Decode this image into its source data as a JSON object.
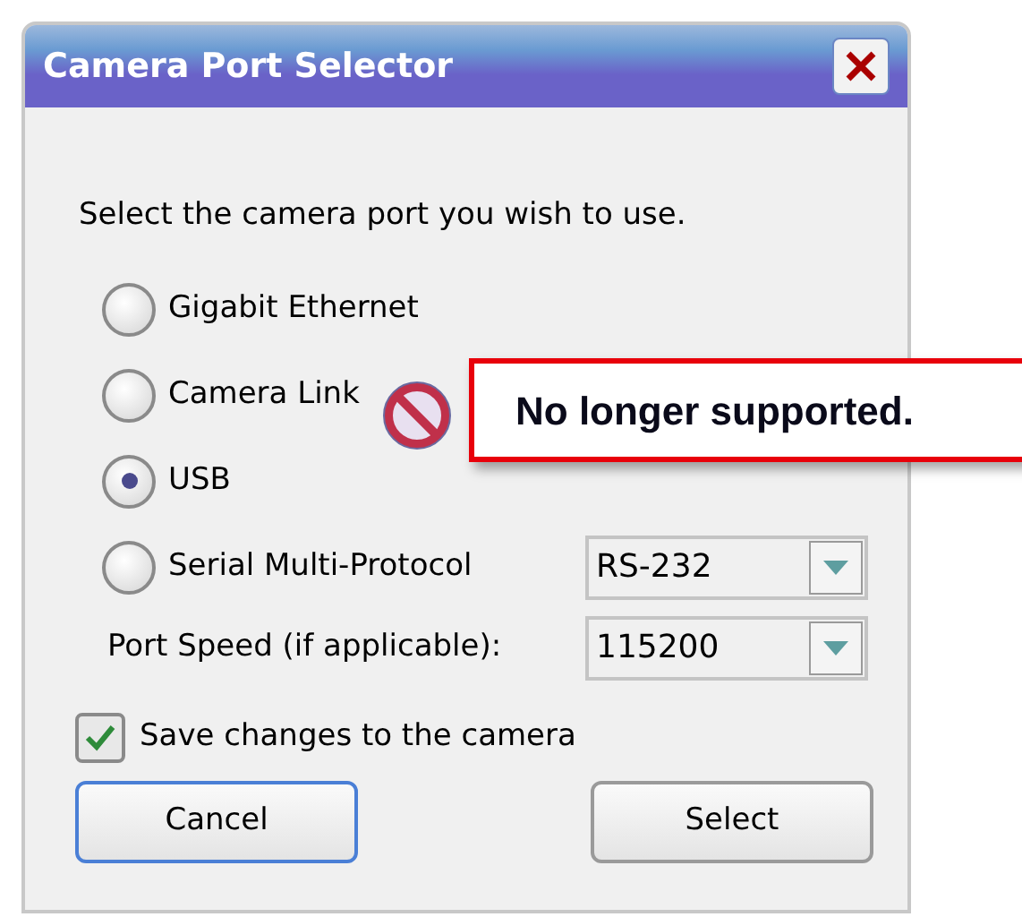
{
  "window": {
    "title": "Camera Port Selector"
  },
  "instruction": "Select the camera port you wish to use.",
  "radios": [
    {
      "label": "Gigabit Ethernet",
      "selected": false
    },
    {
      "label": "Camera Link",
      "selected": false
    },
    {
      "label": "USB",
      "selected": true
    },
    {
      "label": "Serial Multi-Protocol",
      "selected": false
    }
  ],
  "protocol_combo": {
    "value": "RS-232"
  },
  "port_speed": {
    "label": "Port Speed (if applicable):",
    "value": "115200"
  },
  "save_checkbox": {
    "label": "Save changes to the camera",
    "checked": true
  },
  "buttons": [
    {
      "label": "Cancel",
      "focused": true
    },
    {
      "label": "Select",
      "focused": false
    }
  ],
  "callout": {
    "text": "No longer supported."
  }
}
